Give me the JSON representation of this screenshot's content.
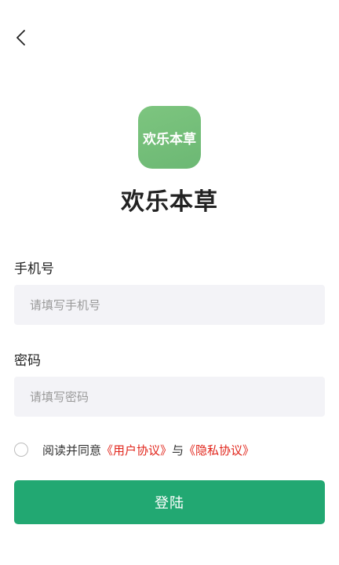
{
  "header": {
    "back_icon": "chevron-left-icon"
  },
  "app": {
    "logo_text": "欢乐本草",
    "name": "欢乐本草",
    "logo_color": "#72bd79"
  },
  "form": {
    "phone": {
      "label": "手机号",
      "placeholder": "请填写手机号",
      "value": ""
    },
    "password": {
      "label": "密码",
      "placeholder": "请填写密码",
      "value": ""
    }
  },
  "agreement": {
    "checked": false,
    "prefix": "阅读并同意",
    "user_agreement": "《用户协议》",
    "joiner": "与",
    "privacy_policy": "《隐私协议》",
    "link_color": "#e1251b"
  },
  "login": {
    "label": "登陆",
    "color": "#22a872"
  }
}
